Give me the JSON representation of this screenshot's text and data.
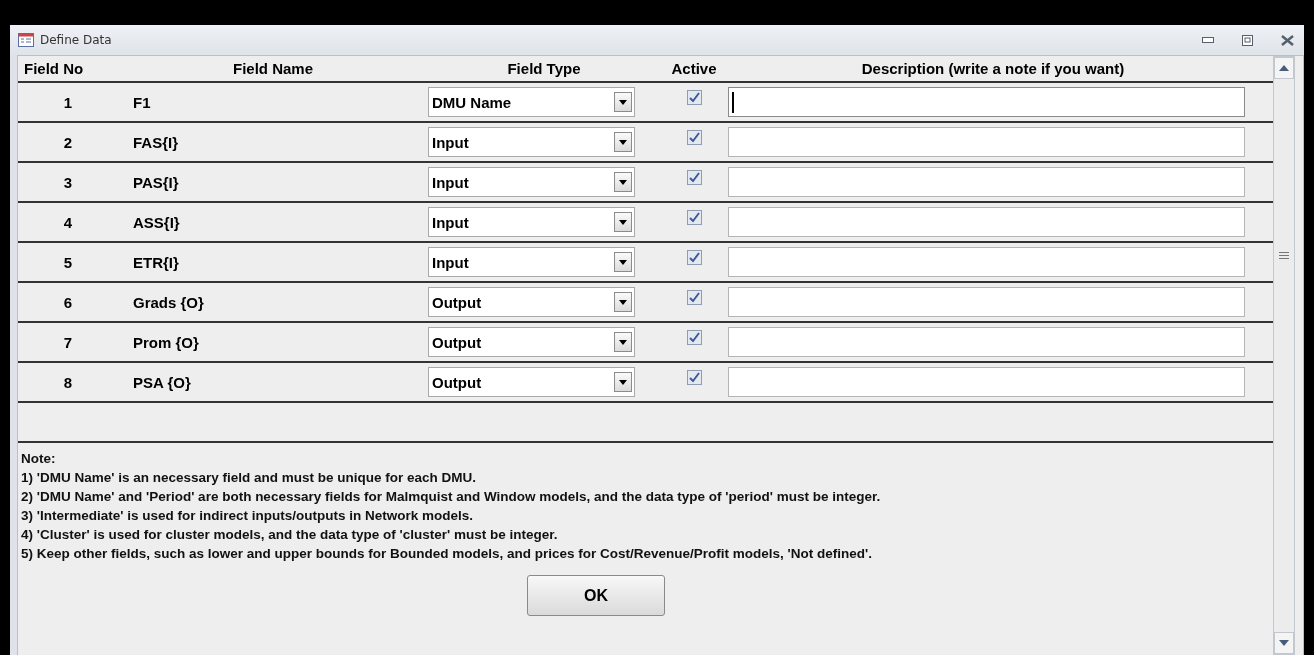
{
  "window": {
    "title": "Define Data"
  },
  "columns": [
    "Field No",
    "Field Name",
    "Field Type",
    "Active",
    "Description (write a note if you want)"
  ],
  "rows": [
    {
      "no": "1",
      "name": "F1",
      "type": "DMU Name",
      "active": true,
      "description": "",
      "focused": true
    },
    {
      "no": "2",
      "name": "FAS{I}",
      "type": "Input",
      "active": true,
      "description": "",
      "focused": false
    },
    {
      "no": "3",
      "name": "PAS{I}",
      "type": "Input",
      "active": true,
      "description": "",
      "focused": false
    },
    {
      "no": "4",
      "name": "ASS{I}",
      "type": "Input",
      "active": true,
      "description": "",
      "focused": false
    },
    {
      "no": "5",
      "name": "ETR{I}",
      "type": "Input",
      "active": true,
      "description": "",
      "focused": false
    },
    {
      "no": "6",
      "name": "Grads {O}",
      "type": "Output",
      "active": true,
      "description": "",
      "focused": false
    },
    {
      "no": "7",
      "name": "Prom {O}",
      "type": "Output",
      "active": true,
      "description": "",
      "focused": false
    },
    {
      "no": "8",
      "name": "PSA {O}",
      "type": "Output",
      "active": true,
      "description": "",
      "focused": false
    }
  ],
  "notes": [
    "Note:",
    "1) 'DMU Name' is an necessary field and must be unique for each DMU.",
    "2) 'DMU Name' and 'Period' are both necessary fields for Malmquist and Window models,  and the data type of 'period' must be integer.",
    "3) 'Intermediate' is used for indirect inputs/outputs  in Network models.",
    "4) 'Cluster' is used for cluster models,  and the data type of  'cluster' must be integer.",
    "5)  Keep other fields, such as lower and upper bounds for Bounded models, and prices for Cost/Revenue/Profit models, 'Not defined'."
  ],
  "ok_button": "OK"
}
